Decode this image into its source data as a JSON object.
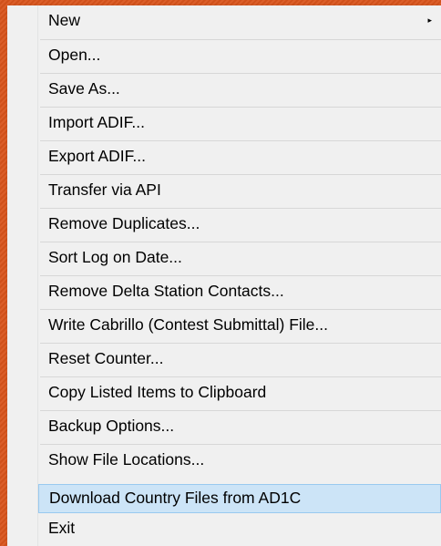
{
  "menu": {
    "items": [
      {
        "label": "New",
        "has_submenu": true,
        "submenu_arrow": "▸"
      },
      {
        "label": "Open..."
      },
      {
        "label": "Save As..."
      },
      {
        "label": "Import ADIF..."
      },
      {
        "label": "Export ADIF..."
      },
      {
        "label": "Transfer via API"
      },
      {
        "label": "Remove Duplicates..."
      },
      {
        "label": "Sort Log on Date..."
      },
      {
        "label": "Remove Delta Station Contacts..."
      },
      {
        "label": "Write Cabrillo (Contest Submittal) File..."
      },
      {
        "label": "Reset Counter..."
      },
      {
        "label": "Copy Listed Items to Clipboard"
      },
      {
        "label": "Backup Options..."
      },
      {
        "label": "Show File Locations..."
      },
      {
        "label": "Download Country Files from AD1C",
        "highlighted": true
      },
      {
        "label": "Exit"
      }
    ]
  },
  "colors": {
    "background": "#d9541c",
    "menu_background": "#f0f0f0",
    "highlight_fill": "#cce4f7",
    "highlight_border": "#99c9ef"
  }
}
